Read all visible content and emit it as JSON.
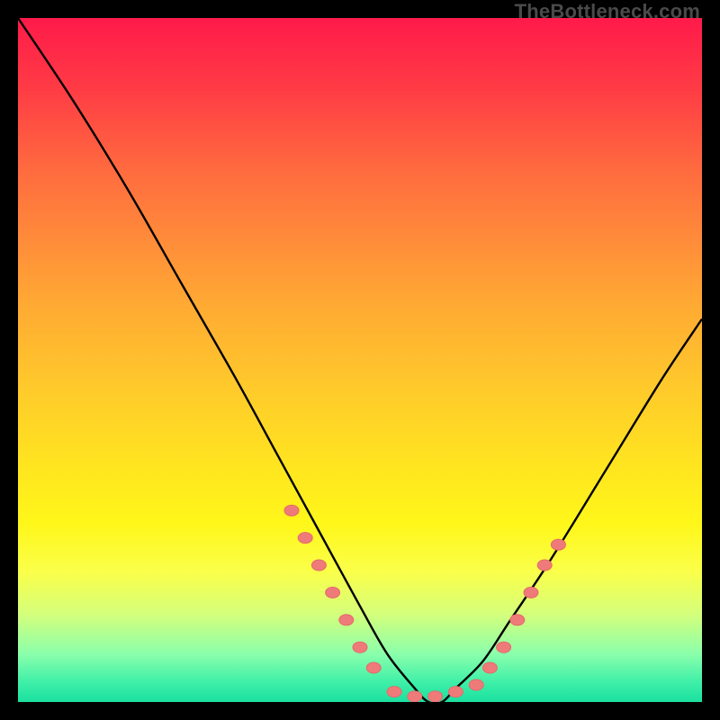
{
  "watermark": "TheBottleneck.com",
  "colors": {
    "background": "#000000",
    "curve_stroke": "#000000",
    "marker_fill": "#ef7a7a",
    "marker_stroke": "#e56a6a"
  },
  "chart_data": {
    "type": "line",
    "title": "",
    "xlabel": "",
    "ylabel": "",
    "xlim": [
      0,
      100
    ],
    "ylim": [
      0,
      100
    ],
    "grid": false,
    "series": [
      {
        "name": "bottleneck-curve",
        "x": [
          0,
          8,
          16,
          24,
          32,
          38,
          44,
          50,
          54,
          58,
          60,
          62,
          64,
          68,
          72,
          78,
          86,
          94,
          100
        ],
        "values": [
          100,
          88,
          75,
          61,
          47,
          36,
          25,
          14,
          7,
          2,
          0,
          0,
          2,
          6,
          12,
          21,
          34,
          47,
          56
        ]
      }
    ],
    "markers": {
      "left_arm": [
        [
          40,
          28
        ],
        [
          42,
          24
        ],
        [
          44,
          20
        ],
        [
          46,
          16
        ],
        [
          48,
          12
        ],
        [
          50,
          8
        ],
        [
          52,
          5
        ]
      ],
      "valley": [
        [
          55,
          1.5
        ],
        [
          58,
          0.8
        ],
        [
          61,
          0.8
        ],
        [
          64,
          1.5
        ],
        [
          67,
          2.5
        ]
      ],
      "right_arm": [
        [
          69,
          5
        ],
        [
          71,
          8
        ],
        [
          73,
          12
        ],
        [
          75,
          16
        ],
        [
          77,
          20
        ],
        [
          79,
          23
        ]
      ]
    }
  }
}
